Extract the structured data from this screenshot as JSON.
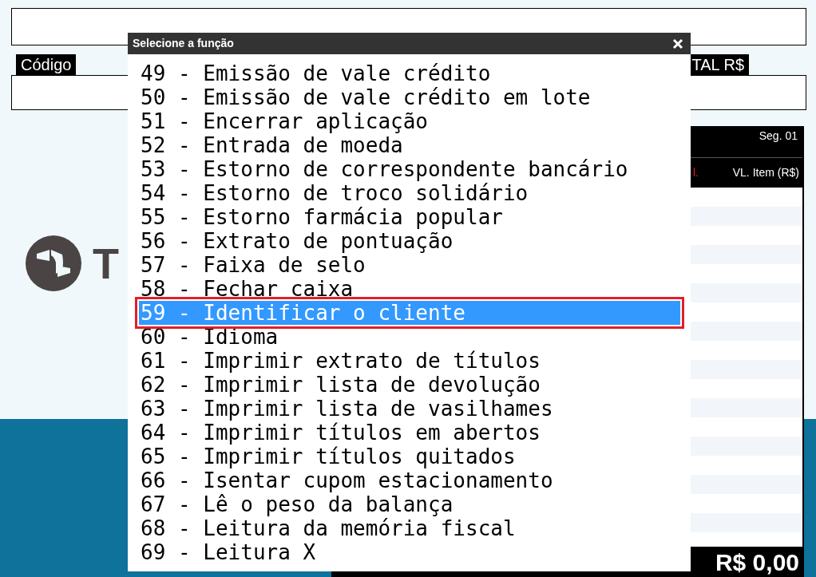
{
  "form": {
    "code_label": "Código",
    "total_label": "TAL R$"
  },
  "logo_text": "T",
  "panel": {
    "segment": "Seg. 01",
    "columns": [
      "l.",
      "VL. Item (R$)"
    ],
    "total": "R$ 0,00"
  },
  "dialog": {
    "title": "Selecione a função",
    "items": [
      {
        "label": "49 - Emissão de vale crédito",
        "selected": false
      },
      {
        "label": "50 - Emissão de vale crédito em lote",
        "selected": false
      },
      {
        "label": "51 - Encerrar aplicação",
        "selected": false
      },
      {
        "label": "52 - Entrada de moeda",
        "selected": false
      },
      {
        "label": "53 - Estorno de correspondente bancário",
        "selected": false
      },
      {
        "label": "54 - Estorno de troco solidário",
        "selected": false
      },
      {
        "label": "55 - Estorno farmácia popular",
        "selected": false
      },
      {
        "label": "56 - Extrato de pontuação",
        "selected": false
      },
      {
        "label": "57 - Faixa de selo",
        "selected": false
      },
      {
        "label": "58 - Fechar caixa",
        "selected": false
      },
      {
        "label": "59 - Identificar o cliente",
        "selected": true
      },
      {
        "label": "60 - Idioma",
        "selected": false
      },
      {
        "label": "61 - Imprimir extrato de títulos",
        "selected": false
      },
      {
        "label": "62 - Imprimir lista de devolução",
        "selected": false
      },
      {
        "label": "63 - Imprimir lista de vasilhames",
        "selected": false
      },
      {
        "label": "64 - Imprimir títulos em abertos",
        "selected": false
      },
      {
        "label": "65 - Imprimir títulos quitados",
        "selected": false
      },
      {
        "label": "66 - Isentar cupom estacionamento",
        "selected": false
      },
      {
        "label": "67 - Lê o peso da balança",
        "selected": false
      },
      {
        "label": "68 - Leitura da memória fiscal",
        "selected": false
      },
      {
        "label": "69 - Leitura X",
        "selected": false
      }
    ]
  }
}
